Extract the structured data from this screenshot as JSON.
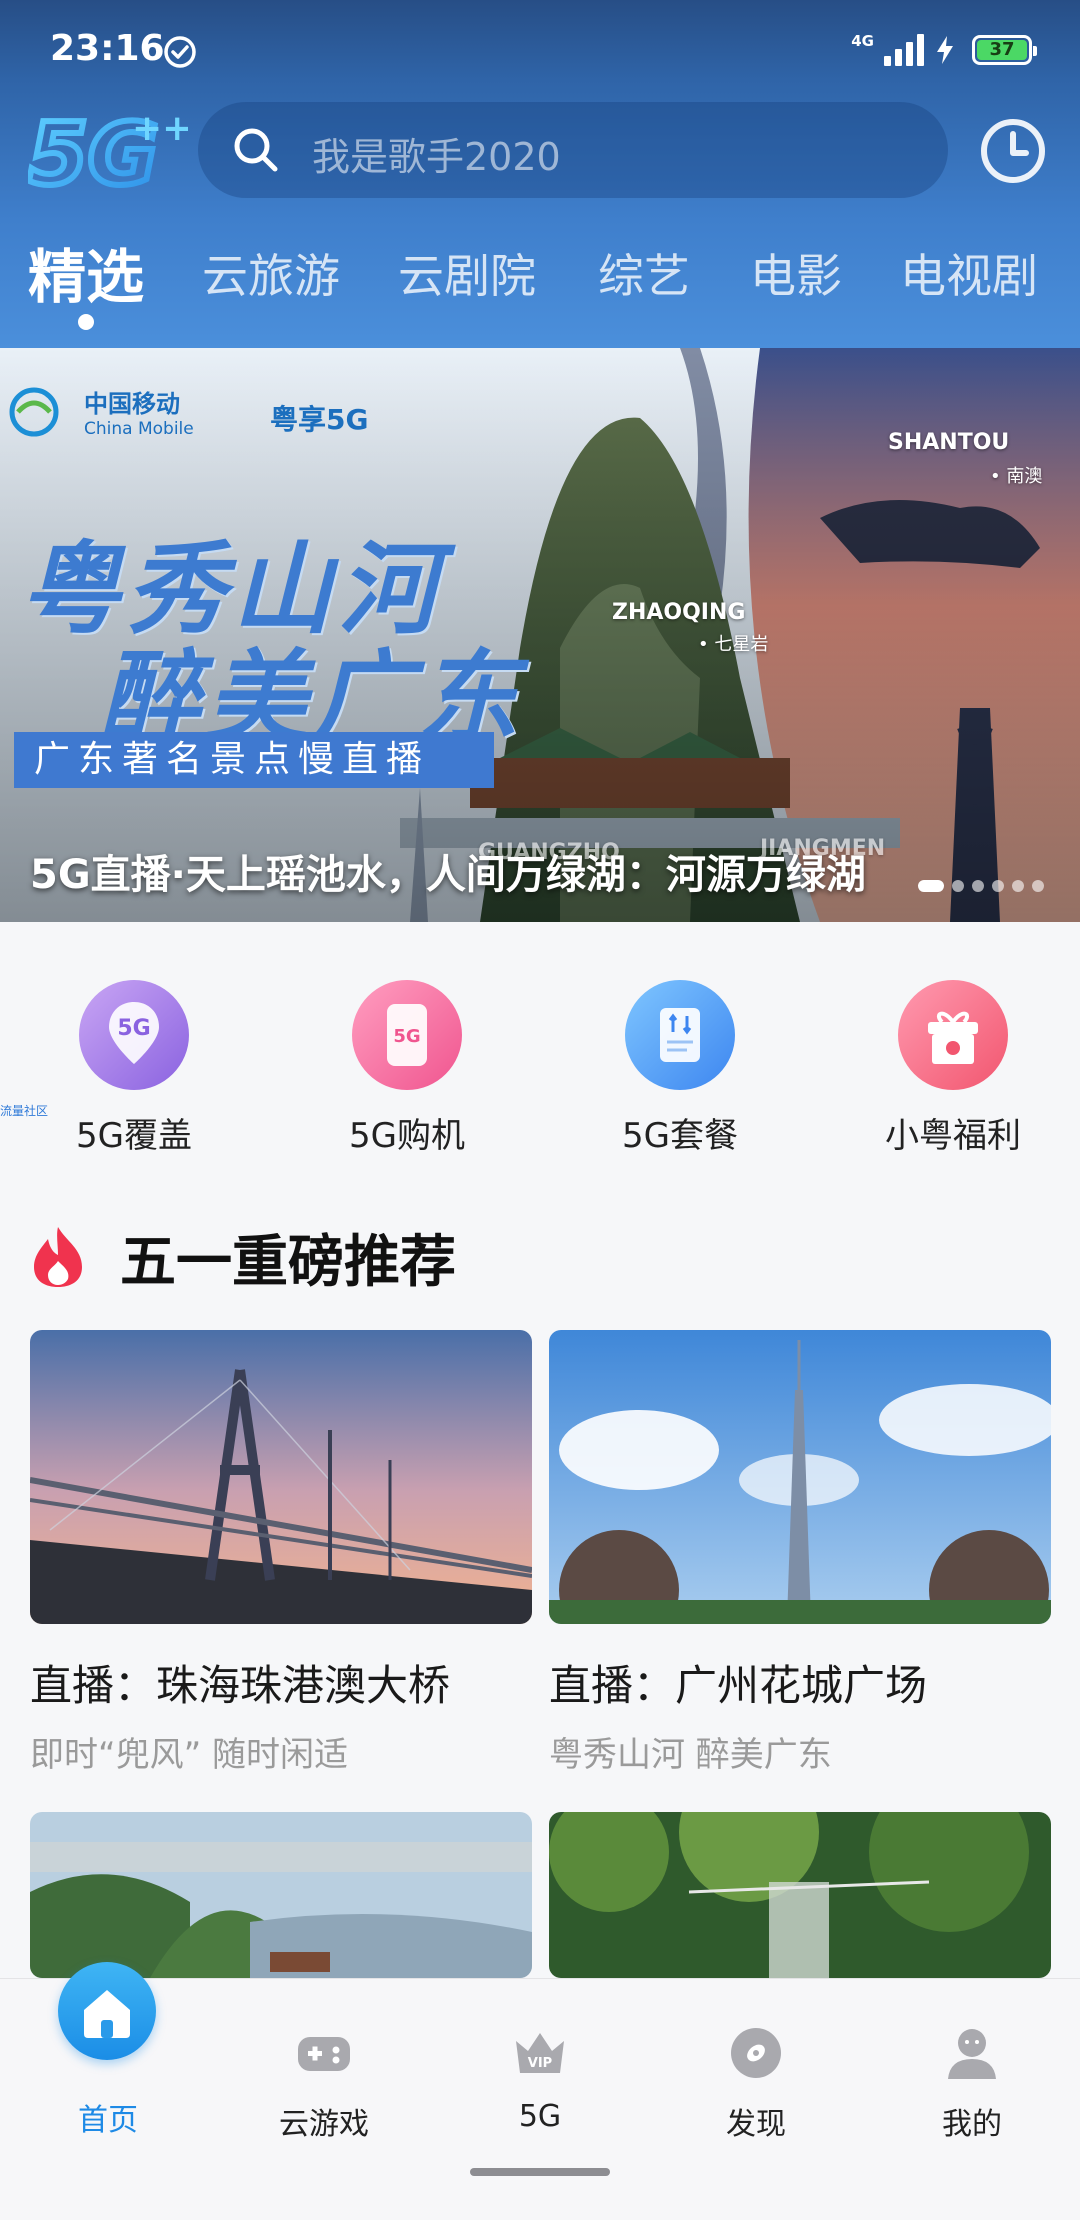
{
  "status_bar": {
    "time": "23:16",
    "network": "4G",
    "battery": "37"
  },
  "header": {
    "search_placeholder": "我是歌手2020",
    "tabs": [
      {
        "label": "精选",
        "active": true
      },
      {
        "label": "云旅游"
      },
      {
        "label": "云剧院"
      },
      {
        "label": "综艺"
      },
      {
        "label": "电影"
      },
      {
        "label": "电视剧"
      }
    ]
  },
  "banner": {
    "brand_cn": "中国移动",
    "brand_en": "China Mobile",
    "brand_2": "粤享5G",
    "headline_1": "粤秀山河",
    "headline_2": "醉美广东",
    "subline": "广东著名景点慢直播",
    "pins": {
      "shantou": "SHANTOU",
      "shantou_sub": "• 南澳",
      "zhaoqing": "ZHAOQING",
      "zhaoqing_sub": "• 七星岩",
      "guangzhou": "GUANGZHO",
      "jiangmen": "JIANGMEN"
    },
    "caption": "5G直播·天上瑶池水，人间万绿湖：河源万绿湖",
    "page_count": 6,
    "active_page": 1
  },
  "quick_entries": [
    {
      "label": "5G覆盖",
      "icon": "location-5g-icon"
    },
    {
      "label": "5G购机",
      "icon": "phone-5g-icon"
    },
    {
      "label": "5G套餐",
      "icon": "package-icon"
    },
    {
      "label": "小粤福利",
      "icon": "gift-icon"
    }
  ],
  "side_tag": "流量社区",
  "section": {
    "title": "五一重磅推荐",
    "cards": [
      {
        "title": "直播：珠海珠港澳大桥",
        "subtitle": "即时“兜风” 随时闲适"
      },
      {
        "title": "直播：广州花城广场",
        "subtitle": "粤秀山河  醉美广东"
      }
    ]
  },
  "bottom_nav": [
    {
      "label": "首页",
      "icon": "home-icon",
      "active": true
    },
    {
      "label": "云游戏",
      "icon": "gamepad-icon"
    },
    {
      "label": "5G",
      "icon": "vip-crown-icon"
    },
    {
      "label": "发现",
      "icon": "discover-icon"
    },
    {
      "label": "我的",
      "icon": "profile-icon"
    }
  ],
  "colors": {
    "header_top": "#274e86",
    "header_bottom": "#4b8fdb",
    "accent_blue": "#1e8ae6",
    "flame_red": "#f0334e"
  }
}
